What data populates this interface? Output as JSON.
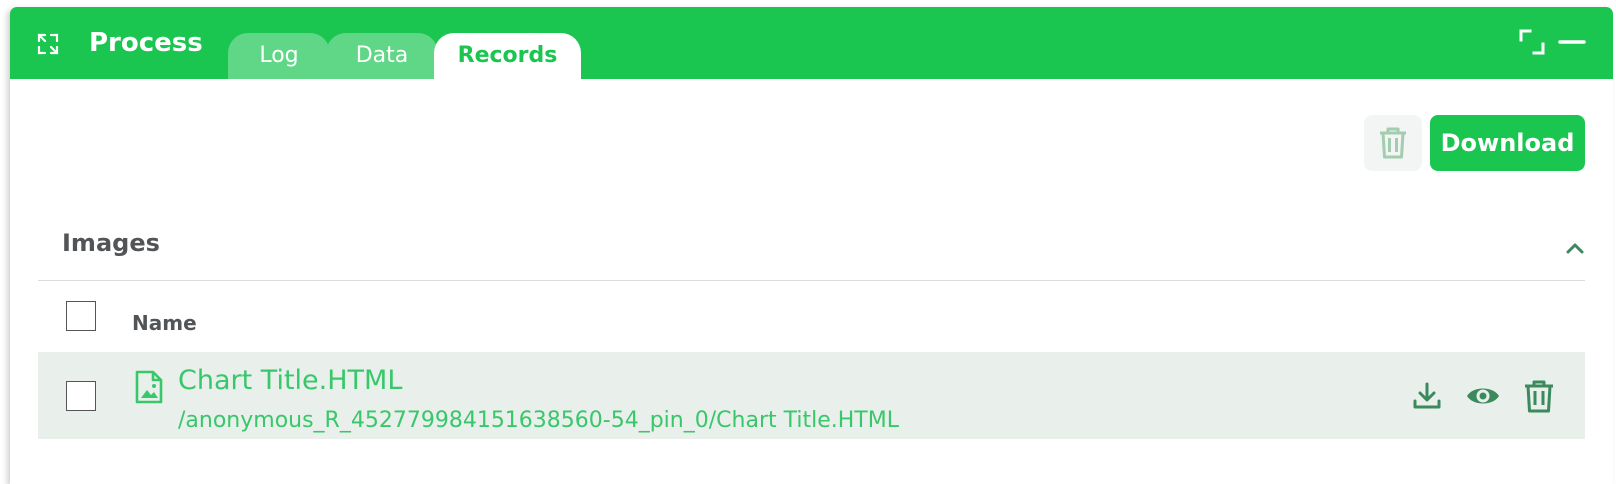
{
  "header": {
    "title": "Process",
    "tabs": [
      {
        "label": "Log",
        "active": false
      },
      {
        "label": "Data",
        "active": false
      },
      {
        "label": "Records",
        "active": true
      }
    ]
  },
  "toolbar": {
    "download_label": "Download"
  },
  "section": {
    "title": "Images",
    "expanded": true
  },
  "table": {
    "columns": [
      "Name"
    ],
    "rows": [
      {
        "name": "Chart Title.HTML",
        "path": "/anonymous_R_452779984151638560-54_pin_0/Chart Title.HTML",
        "checked": false
      }
    ]
  },
  "colors": {
    "accent": "#1ac550",
    "tab_inactive": "#5fd786",
    "row_bg": "#e9efeb",
    "icon_green": "#3a8a5e",
    "text_dark": "#525558"
  },
  "icons": {
    "process": "expand-arrows-icon",
    "maximize": "maximize-icon",
    "minimize": "minimize-icon",
    "delete": "trash-icon",
    "collapse": "chevron-up-icon",
    "file": "image-file-icon",
    "row_download": "download-icon",
    "row_view": "eye-icon",
    "row_delete": "trash-icon"
  }
}
